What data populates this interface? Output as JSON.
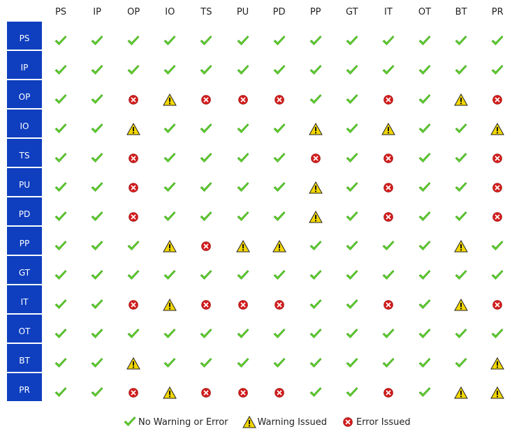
{
  "columns": [
    "PS",
    "IP",
    "OP",
    "IO",
    "TS",
    "PU",
    "PD",
    "PP",
    "GT",
    "IT",
    "OT",
    "BT",
    "PR"
  ],
  "rows": [
    {
      "label": "PS",
      "cells": [
        "ok",
        "ok",
        "ok",
        "ok",
        "ok",
        "ok",
        "ok",
        "ok",
        "ok",
        "ok",
        "ok",
        "ok",
        "ok"
      ]
    },
    {
      "label": "IP",
      "cells": [
        "ok",
        "ok",
        "ok",
        "ok",
        "ok",
        "ok",
        "ok",
        "ok",
        "ok",
        "ok",
        "ok",
        "ok",
        "ok"
      ]
    },
    {
      "label": "OP",
      "cells": [
        "ok",
        "ok",
        "error",
        "warning",
        "error",
        "error",
        "error",
        "ok",
        "ok",
        "error",
        "ok",
        "warning",
        "error"
      ]
    },
    {
      "label": "IO",
      "cells": [
        "ok",
        "ok",
        "warning",
        "ok",
        "ok",
        "ok",
        "ok",
        "warning",
        "ok",
        "warning",
        "ok",
        "ok",
        "warning"
      ]
    },
    {
      "label": "TS",
      "cells": [
        "ok",
        "ok",
        "error",
        "ok",
        "ok",
        "ok",
        "ok",
        "error",
        "ok",
        "error",
        "ok",
        "ok",
        "error"
      ]
    },
    {
      "label": "PU",
      "cells": [
        "ok",
        "ok",
        "error",
        "ok",
        "ok",
        "ok",
        "ok",
        "warning",
        "ok",
        "error",
        "ok",
        "ok",
        "error"
      ]
    },
    {
      "label": "PD",
      "cells": [
        "ok",
        "ok",
        "error",
        "ok",
        "ok",
        "ok",
        "ok",
        "warning",
        "ok",
        "error",
        "ok",
        "ok",
        "error"
      ]
    },
    {
      "label": "PP",
      "cells": [
        "ok",
        "ok",
        "ok",
        "warning",
        "error",
        "warning",
        "warning",
        "ok",
        "ok",
        "ok",
        "ok",
        "warning",
        "ok"
      ]
    },
    {
      "label": "GT",
      "cells": [
        "ok",
        "ok",
        "ok",
        "ok",
        "ok",
        "ok",
        "ok",
        "ok",
        "ok",
        "ok",
        "ok",
        "ok",
        "ok"
      ]
    },
    {
      "label": "IT",
      "cells": [
        "ok",
        "ok",
        "error",
        "warning",
        "error",
        "error",
        "error",
        "ok",
        "ok",
        "error",
        "ok",
        "warning",
        "error"
      ]
    },
    {
      "label": "OT",
      "cells": [
        "ok",
        "ok",
        "ok",
        "ok",
        "ok",
        "ok",
        "ok",
        "ok",
        "ok",
        "ok",
        "ok",
        "ok",
        "ok"
      ]
    },
    {
      "label": "BT",
      "cells": [
        "ok",
        "ok",
        "warning",
        "ok",
        "ok",
        "ok",
        "ok",
        "ok",
        "ok",
        "ok",
        "ok",
        "ok",
        "warning"
      ]
    },
    {
      "label": "PR",
      "cells": [
        "ok",
        "ok",
        "error",
        "warning",
        "error",
        "error",
        "error",
        "ok",
        "ok",
        "error",
        "ok",
        "warning",
        "warning"
      ]
    }
  ],
  "legend": {
    "ok_label": "No Warning or Error",
    "warning_label": "Warning Issued",
    "error_label": "Error Issued"
  },
  "icons": {
    "ok": "check-icon",
    "warning": "warning-icon",
    "error": "error-icon"
  },
  "colors": {
    "row_header_bg": "#0f3fbf",
    "ok": "#5fd12e",
    "warning": "#f2d600",
    "error": "#d41c1c"
  }
}
